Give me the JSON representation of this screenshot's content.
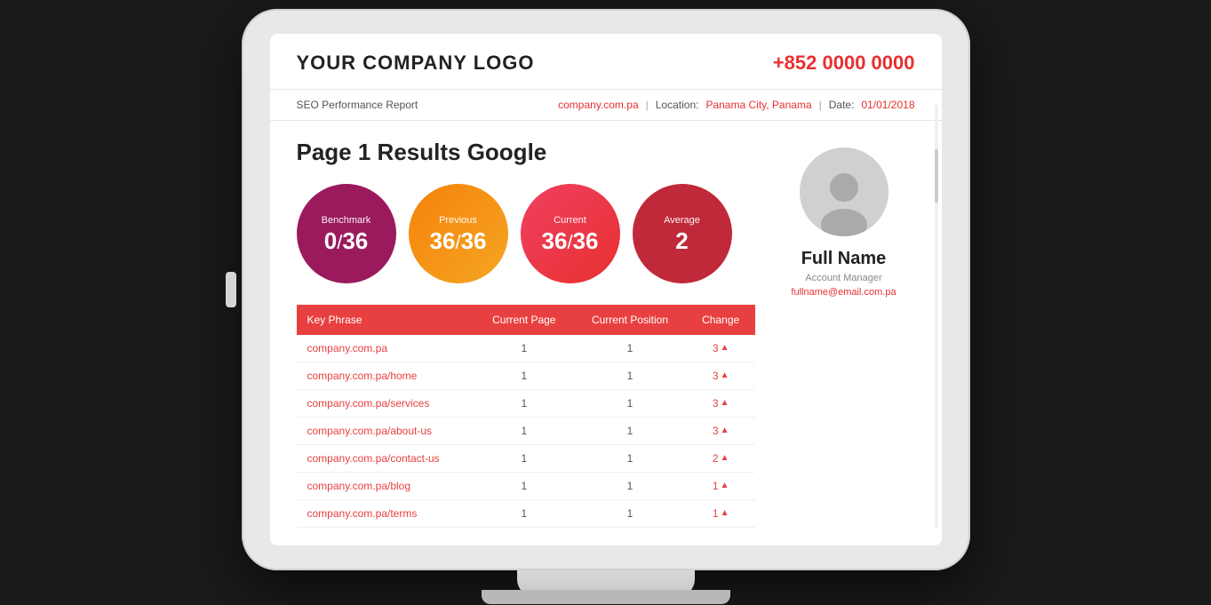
{
  "header": {
    "logo": "YOUR COMPANY LOGO",
    "phone": "+852 0000 0000"
  },
  "subheader": {
    "report_title": "SEO Performance Report",
    "website": "company.com.pa",
    "location_label": "Location:",
    "location_value": "Panama City, Panama",
    "date_label": "Date:",
    "date_value": "01/01/2018"
  },
  "page_title": "Page 1 Results Google",
  "stats": {
    "benchmark": {
      "label": "Benchmark",
      "value": "0",
      "slash": "/",
      "total": "36"
    },
    "previous": {
      "label": "Previous",
      "value": "36",
      "slash": "/",
      "total": "36"
    },
    "current": {
      "label": "Current",
      "value": "36",
      "slash": "/",
      "total": "36"
    },
    "average": {
      "label": "Average",
      "value": "2"
    }
  },
  "account": {
    "full_name": "Full Name",
    "role": "Account Manager",
    "email": "fullname@email.com.pa"
  },
  "table": {
    "headers": [
      "Key Phrase",
      "Current Page",
      "Current Position",
      "Change"
    ],
    "rows": [
      {
        "phrase": "company.com.pa",
        "page": "1",
        "position": "1",
        "change": "3"
      },
      {
        "phrase": "company.com.pa/home",
        "page": "1",
        "position": "1",
        "change": "3"
      },
      {
        "phrase": "company.com.pa/services",
        "page": "1",
        "position": "1",
        "change": "3"
      },
      {
        "phrase": "company.com.pa/about-us",
        "page": "1",
        "position": "1",
        "change": "3"
      },
      {
        "phrase": "company.com.pa/contact-us",
        "page": "1",
        "position": "1",
        "change": "2"
      },
      {
        "phrase": "company.com.pa/blog",
        "page": "1",
        "position": "1",
        "change": "1"
      },
      {
        "phrase": "company.com.pa/terms",
        "page": "1",
        "position": "1",
        "change": "1"
      }
    ]
  }
}
